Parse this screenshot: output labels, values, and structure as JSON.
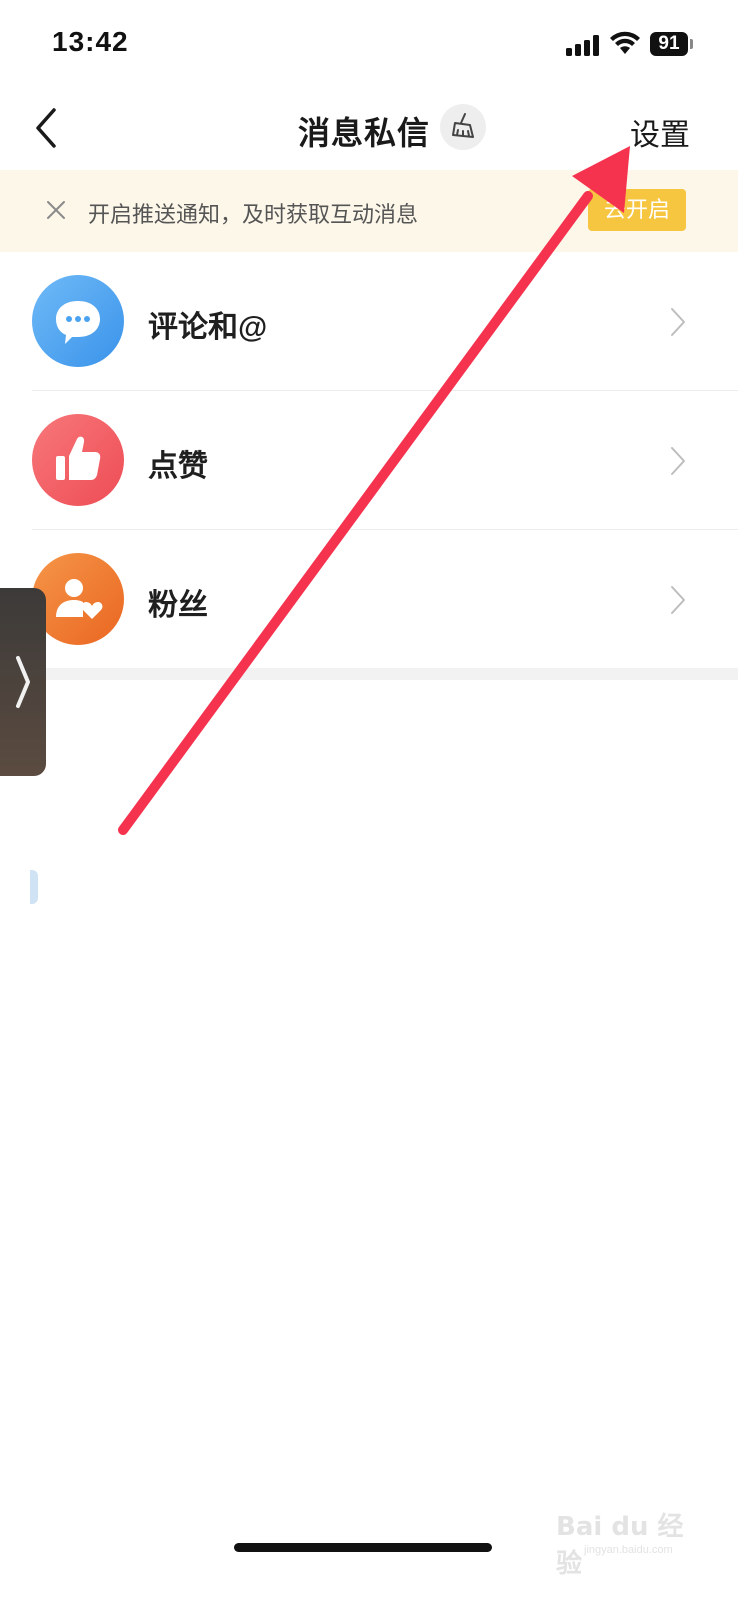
{
  "status_bar": {
    "time": "13:42",
    "battery": "91"
  },
  "nav": {
    "title": "消息私信",
    "settings_label": "设置"
  },
  "banner": {
    "text": "开启推送通知，及时获取互动消息",
    "button_label": "去开启"
  },
  "list_items": [
    {
      "label": "评论和@",
      "icon": "chat-bubble-icon",
      "color": "#4aa3f0"
    },
    {
      "label": "点赞",
      "icon": "thumbs-up-icon",
      "color": "#f1585d"
    },
    {
      "label": "粉丝",
      "icon": "fan-user-heart-icon",
      "color": "#f0782f"
    }
  ],
  "colors": {
    "banner_bg": "#fdf7ea",
    "banner_button": "#f7c640",
    "annotation_arrow": "#f5334f"
  },
  "watermark": {
    "main": "Bai du 经验",
    "sub": "jingyan.baidu.com"
  }
}
